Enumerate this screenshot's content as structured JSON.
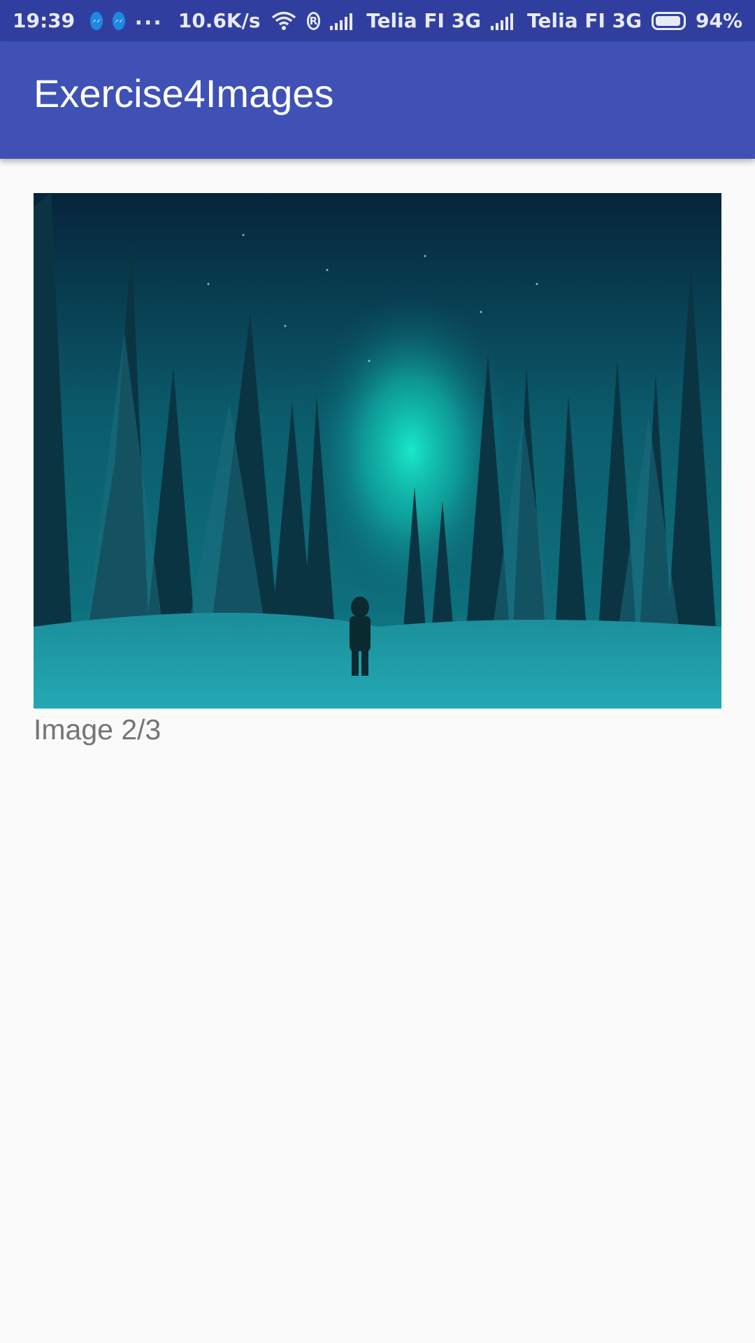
{
  "status_bar": {
    "time": "19:39",
    "icons": [
      "messenger-icon",
      "messenger-icon",
      "more-notifications-icon",
      "wifi-icon",
      "roaming-icon",
      "signal-icon",
      "signal-icon",
      "battery-icon"
    ],
    "more_label": "...",
    "net_speed": "10.6K/s",
    "roaming_label": "R",
    "carrier_1": "Telia FI 3G",
    "carrier_2": "Telia FI 3G",
    "battery_percent": "94%",
    "battery_level": 0.94
  },
  "app_bar": {
    "title": "Exercise4Images",
    "color": "#3f51b5",
    "status_color": "#303f9f"
  },
  "content": {
    "image_icon": "aurora-forest-photo",
    "caption": "Image 2/3"
  }
}
